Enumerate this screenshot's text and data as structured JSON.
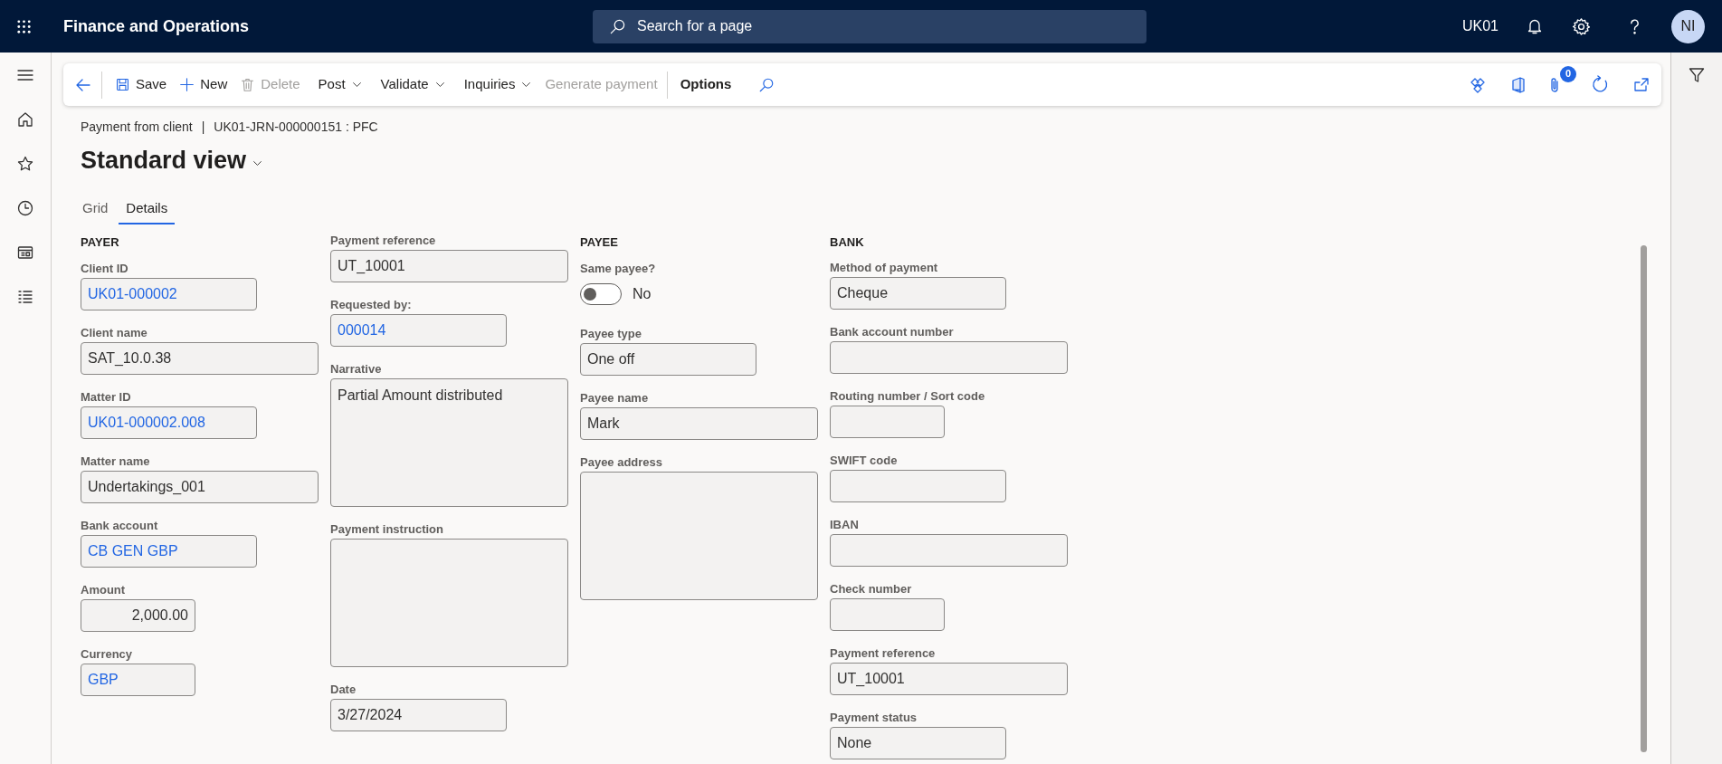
{
  "app": {
    "title": "Finance and Operations",
    "search_placeholder": "Search for a page",
    "company": "UK01",
    "avatar": "NI"
  },
  "toolbar": {
    "items": [
      {
        "kind": "button",
        "label": "Save",
        "disabled": false
      },
      {
        "kind": "button",
        "label": "New",
        "disabled": false
      },
      {
        "kind": "button",
        "label": "Delete",
        "disabled": true
      },
      {
        "kind": "menu",
        "label": "Post",
        "disabled": false
      },
      {
        "kind": "menu",
        "label": "Validate",
        "disabled": false
      },
      {
        "kind": "menu",
        "label": "Inquiries",
        "disabled": false
      },
      {
        "kind": "button",
        "label": "Generate payment",
        "disabled": true
      },
      {
        "kind": "tab",
        "label": "Options",
        "disabled": false
      }
    ],
    "attachments_badge": "0"
  },
  "breadcrumb": {
    "parts": [
      "Payment from client",
      "UK01-JRN-000000151 : PFC"
    ],
    "separator": "|"
  },
  "view_title": "Standard view",
  "tabs": [
    {
      "label": "Grid",
      "selected": false
    },
    {
      "label": "Details",
      "selected": true
    }
  ],
  "columns": [
    {
      "heading": "PAYER",
      "fields": [
        {
          "label": "Client ID",
          "kind": "link",
          "value": "UK01-000002"
        },
        {
          "label": "Client name",
          "kind": "text",
          "value": "SAT_10.0.38"
        },
        {
          "label": "Matter ID",
          "kind": "link",
          "value": "UK01-000002.008"
        },
        {
          "label": "Matter name",
          "kind": "text",
          "value": "Undertakings_001"
        },
        {
          "label": "Bank account",
          "kind": "link",
          "value": "CB GEN GBP"
        },
        {
          "label": "Amount",
          "kind": "number",
          "value": "2,000.00"
        },
        {
          "label": "Currency",
          "kind": "link",
          "value": "GBP"
        }
      ]
    },
    {
      "fields": [
        {
          "label": "Payment reference",
          "kind": "text",
          "value": "UT_10001"
        },
        {
          "label": "Requested by:",
          "kind": "link",
          "value": "000014"
        },
        {
          "label": "Narrative",
          "kind": "textarea",
          "value": "Partial Amount distributed"
        },
        {
          "label": "Payment instruction",
          "kind": "textarea"
        },
        {
          "label": "Date",
          "kind": "text",
          "value": "3/27/2024"
        }
      ]
    },
    {
      "heading": "PAYEE",
      "fields": [
        {
          "label": "Same payee?",
          "kind": "toggle",
          "on": false,
          "value": "No"
        },
        {
          "label": "Payee type",
          "kind": "text",
          "value": "One off"
        },
        {
          "label": "Payee name",
          "kind": "text",
          "value": "Mark"
        },
        {
          "label": "Payee address",
          "kind": "textarea"
        }
      ]
    },
    {
      "heading": "BANK",
      "fields": [
        {
          "label": "Method of payment",
          "kind": "text",
          "value": "Cheque"
        },
        {
          "label": "Bank account number",
          "kind": "text"
        },
        {
          "label": "Routing number / Sort code",
          "kind": "text"
        },
        {
          "label": "SWIFT code",
          "kind": "text"
        },
        {
          "label": "IBAN",
          "kind": "text"
        },
        {
          "label": "Check number",
          "kind": "text"
        },
        {
          "label": "Payment reference",
          "kind": "text",
          "value": "UT_10001"
        },
        {
          "label": "Payment status",
          "kind": "text",
          "value": "None"
        }
      ]
    }
  ]
}
